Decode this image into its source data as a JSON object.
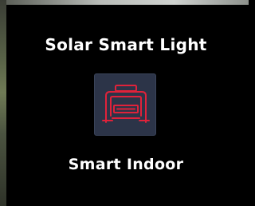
{
  "card": {
    "title": "Solar Smart Light",
    "icon": "indoor-light-icon",
    "label": "Smart Indoor",
    "colors": {
      "background": "#000000",
      "icon_tile": "#2c3448",
      "icon_stroke": "#e0223a",
      "text": "#ffffff"
    }
  }
}
